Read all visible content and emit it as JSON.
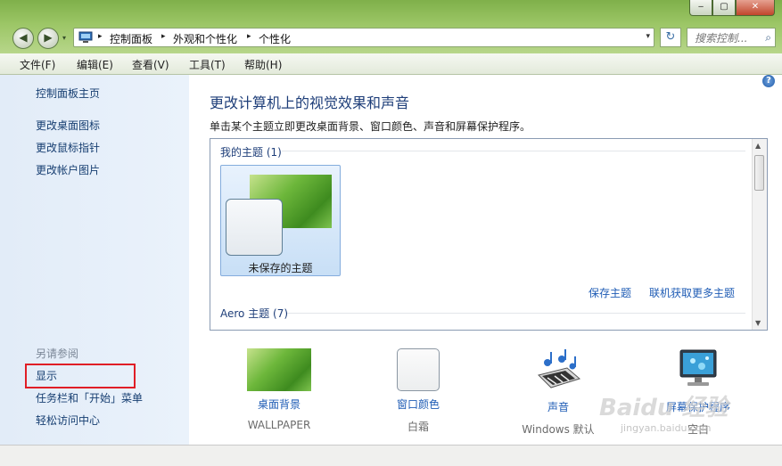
{
  "window": {
    "caption": {
      "minimize": "‒",
      "maximize": "▢",
      "close": "✕"
    },
    "back": "◀",
    "forward": "▶"
  },
  "address": {
    "crumbs": [
      "控制面板",
      "外观和个性化",
      "个性化"
    ],
    "separator": "▸",
    "dropdown": "▾",
    "refresh": "↻",
    "search_placeholder": "搜索控制...",
    "search_icon": "⌕"
  },
  "menu": [
    "文件(F)",
    "编辑(E)",
    "查看(V)",
    "工具(T)",
    "帮助(H)"
  ],
  "sidebar": {
    "home": "控制面板主页",
    "links": [
      "更改桌面图标",
      "更改鼠标指针",
      "更改帐户图片"
    ],
    "see_also_label": "另请参阅",
    "see_also": [
      "显示",
      "任务栏和「开始」菜单",
      "轻松访问中心"
    ]
  },
  "main": {
    "help": "?",
    "title": "更改计算机上的视觉效果和声音",
    "description": "单击某个主题立即更改桌面背景、窗口颜色、声音和屏幕保护程序。",
    "my_themes": "我的主题 (1)",
    "unsaved_theme": "未保存的主题",
    "save_theme": "保存主题",
    "more_themes": "联机获取更多主题",
    "aero_themes": "Aero 主题 (7)",
    "scroll_up": "▲",
    "scroll_down": "▼"
  },
  "tools": [
    {
      "name": "桌面背景",
      "value": "WALLPAPER"
    },
    {
      "name": "窗口颜色",
      "value": "白霜"
    },
    {
      "name": "声音",
      "value": "Windows 默认"
    },
    {
      "name": "屏幕保护程序",
      "value": "空白"
    }
  ],
  "watermark": {
    "brand": "Baidu 经验",
    "url": "jingyan.baidu.com"
  },
  "colors": {
    "accent_link": "#1f5cb5",
    "title": "#1e3e79",
    "highlight_box": "#e01e26",
    "frame": "#9cc666"
  }
}
